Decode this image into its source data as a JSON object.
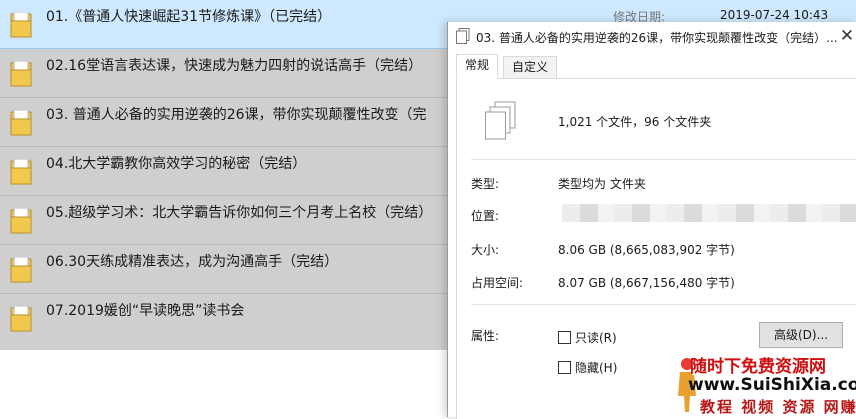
{
  "file_list": {
    "rows": [
      {
        "name": "01.《普通人快速崛起31节修炼课》（已完结）",
        "modified_label": "修改日期:",
        "modified_value": "2019-07-24 10:43"
      },
      {
        "name": "02.16堂语言表达课，快速成为魅力四射的说话高手（完结）"
      },
      {
        "name": "03. 普通人必备的实用逆袭的26课，带你实现颠覆性改变（完"
      },
      {
        "name": "04.北大学霸教你高效学习的秘密（完结）"
      },
      {
        "name": "05.超级学习术：北大学霸告诉你如何三个月考上名校（完结）"
      },
      {
        "name": "06.30天练成精准表达，成为沟通高手（完结）"
      },
      {
        "name": "07.2019媛创“早读晚思”读书会"
      }
    ]
  },
  "dialog": {
    "title": "03. 普通人必备的实用逆袭的26课，带你实现颠覆性改变（完结）...",
    "close_glyph": "✕",
    "tabs": [
      "常规",
      "自定义"
    ],
    "summary": "1,021 个文件，96 个文件夹",
    "type_label": "类型:",
    "type_value": "类型均为 文件夹",
    "location_label": "位置:",
    "size_label": "大小:",
    "size_value": "8.06 GB (8,665,083,902 字节)",
    "disk_label": "占用空间:",
    "disk_value": "8.07 GB (8,667,156,480 字节)",
    "attr_label": "属性:",
    "readonly_label": "只读(R)",
    "hidden_label": "隐藏(H)",
    "advanced_label": "高级(D)..."
  },
  "watermark": {
    "line1": "随时下免费资源网",
    "line2": "www.SuiShiXia.com",
    "line3": "教程 视频 资源 网赚"
  },
  "colors": {
    "selected_row": "#cde8ff",
    "folder": "#f2c94c",
    "watermark_red": "#d01010"
  }
}
